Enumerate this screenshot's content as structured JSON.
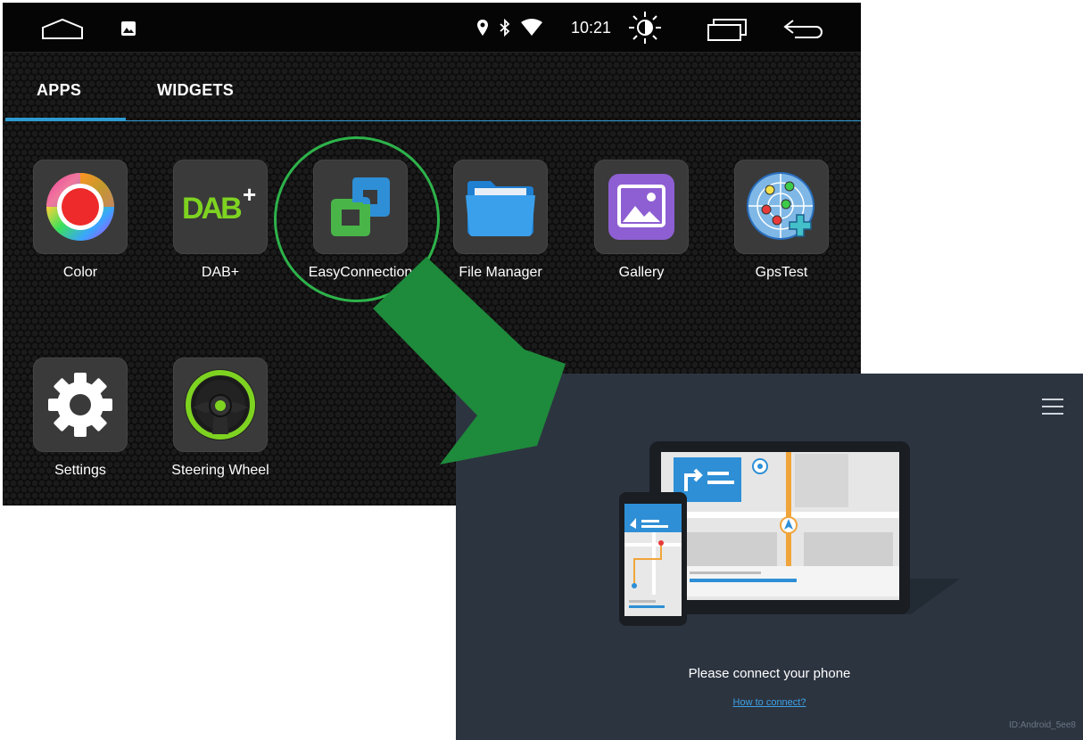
{
  "status_bar": {
    "time": "10:21",
    "icons": [
      "home-icon",
      "gallery-notification-icon",
      "location-icon",
      "bluetooth-icon",
      "wifi-icon",
      "brightness-icon",
      "recent-apps-icon",
      "back-icon"
    ]
  },
  "tabs": [
    {
      "label": "APPS",
      "active": true
    },
    {
      "label": "WIDGETS",
      "active": false
    }
  ],
  "apps": [
    {
      "label": "Color",
      "icon": "color-wheel-icon"
    },
    {
      "label": "DAB+",
      "icon": "dab-plus-icon"
    },
    {
      "label": "EasyConnection",
      "icon": "easyconnection-icon",
      "highlighted": true
    },
    {
      "label": "File Manager",
      "icon": "folder-icon"
    },
    {
      "label": "Gallery",
      "icon": "gallery-icon"
    },
    {
      "label": "GpsTest",
      "icon": "gps-radar-icon"
    },
    {
      "label": "Settings",
      "icon": "gear-icon"
    },
    {
      "label": "Steering Wheel",
      "icon": "steering-wheel-icon"
    }
  ],
  "easyconnection": {
    "prompt": "Please connect your phone",
    "help_link": "How to connect?",
    "device_id": "ID:Android_5ee8"
  },
  "colors": {
    "accent_blue": "#2e9bd1",
    "highlight_green": "#2db34a",
    "arrow_green": "#1e8a3b",
    "panel_bg": "#2c3440",
    "link_blue": "#3ea2e6"
  }
}
